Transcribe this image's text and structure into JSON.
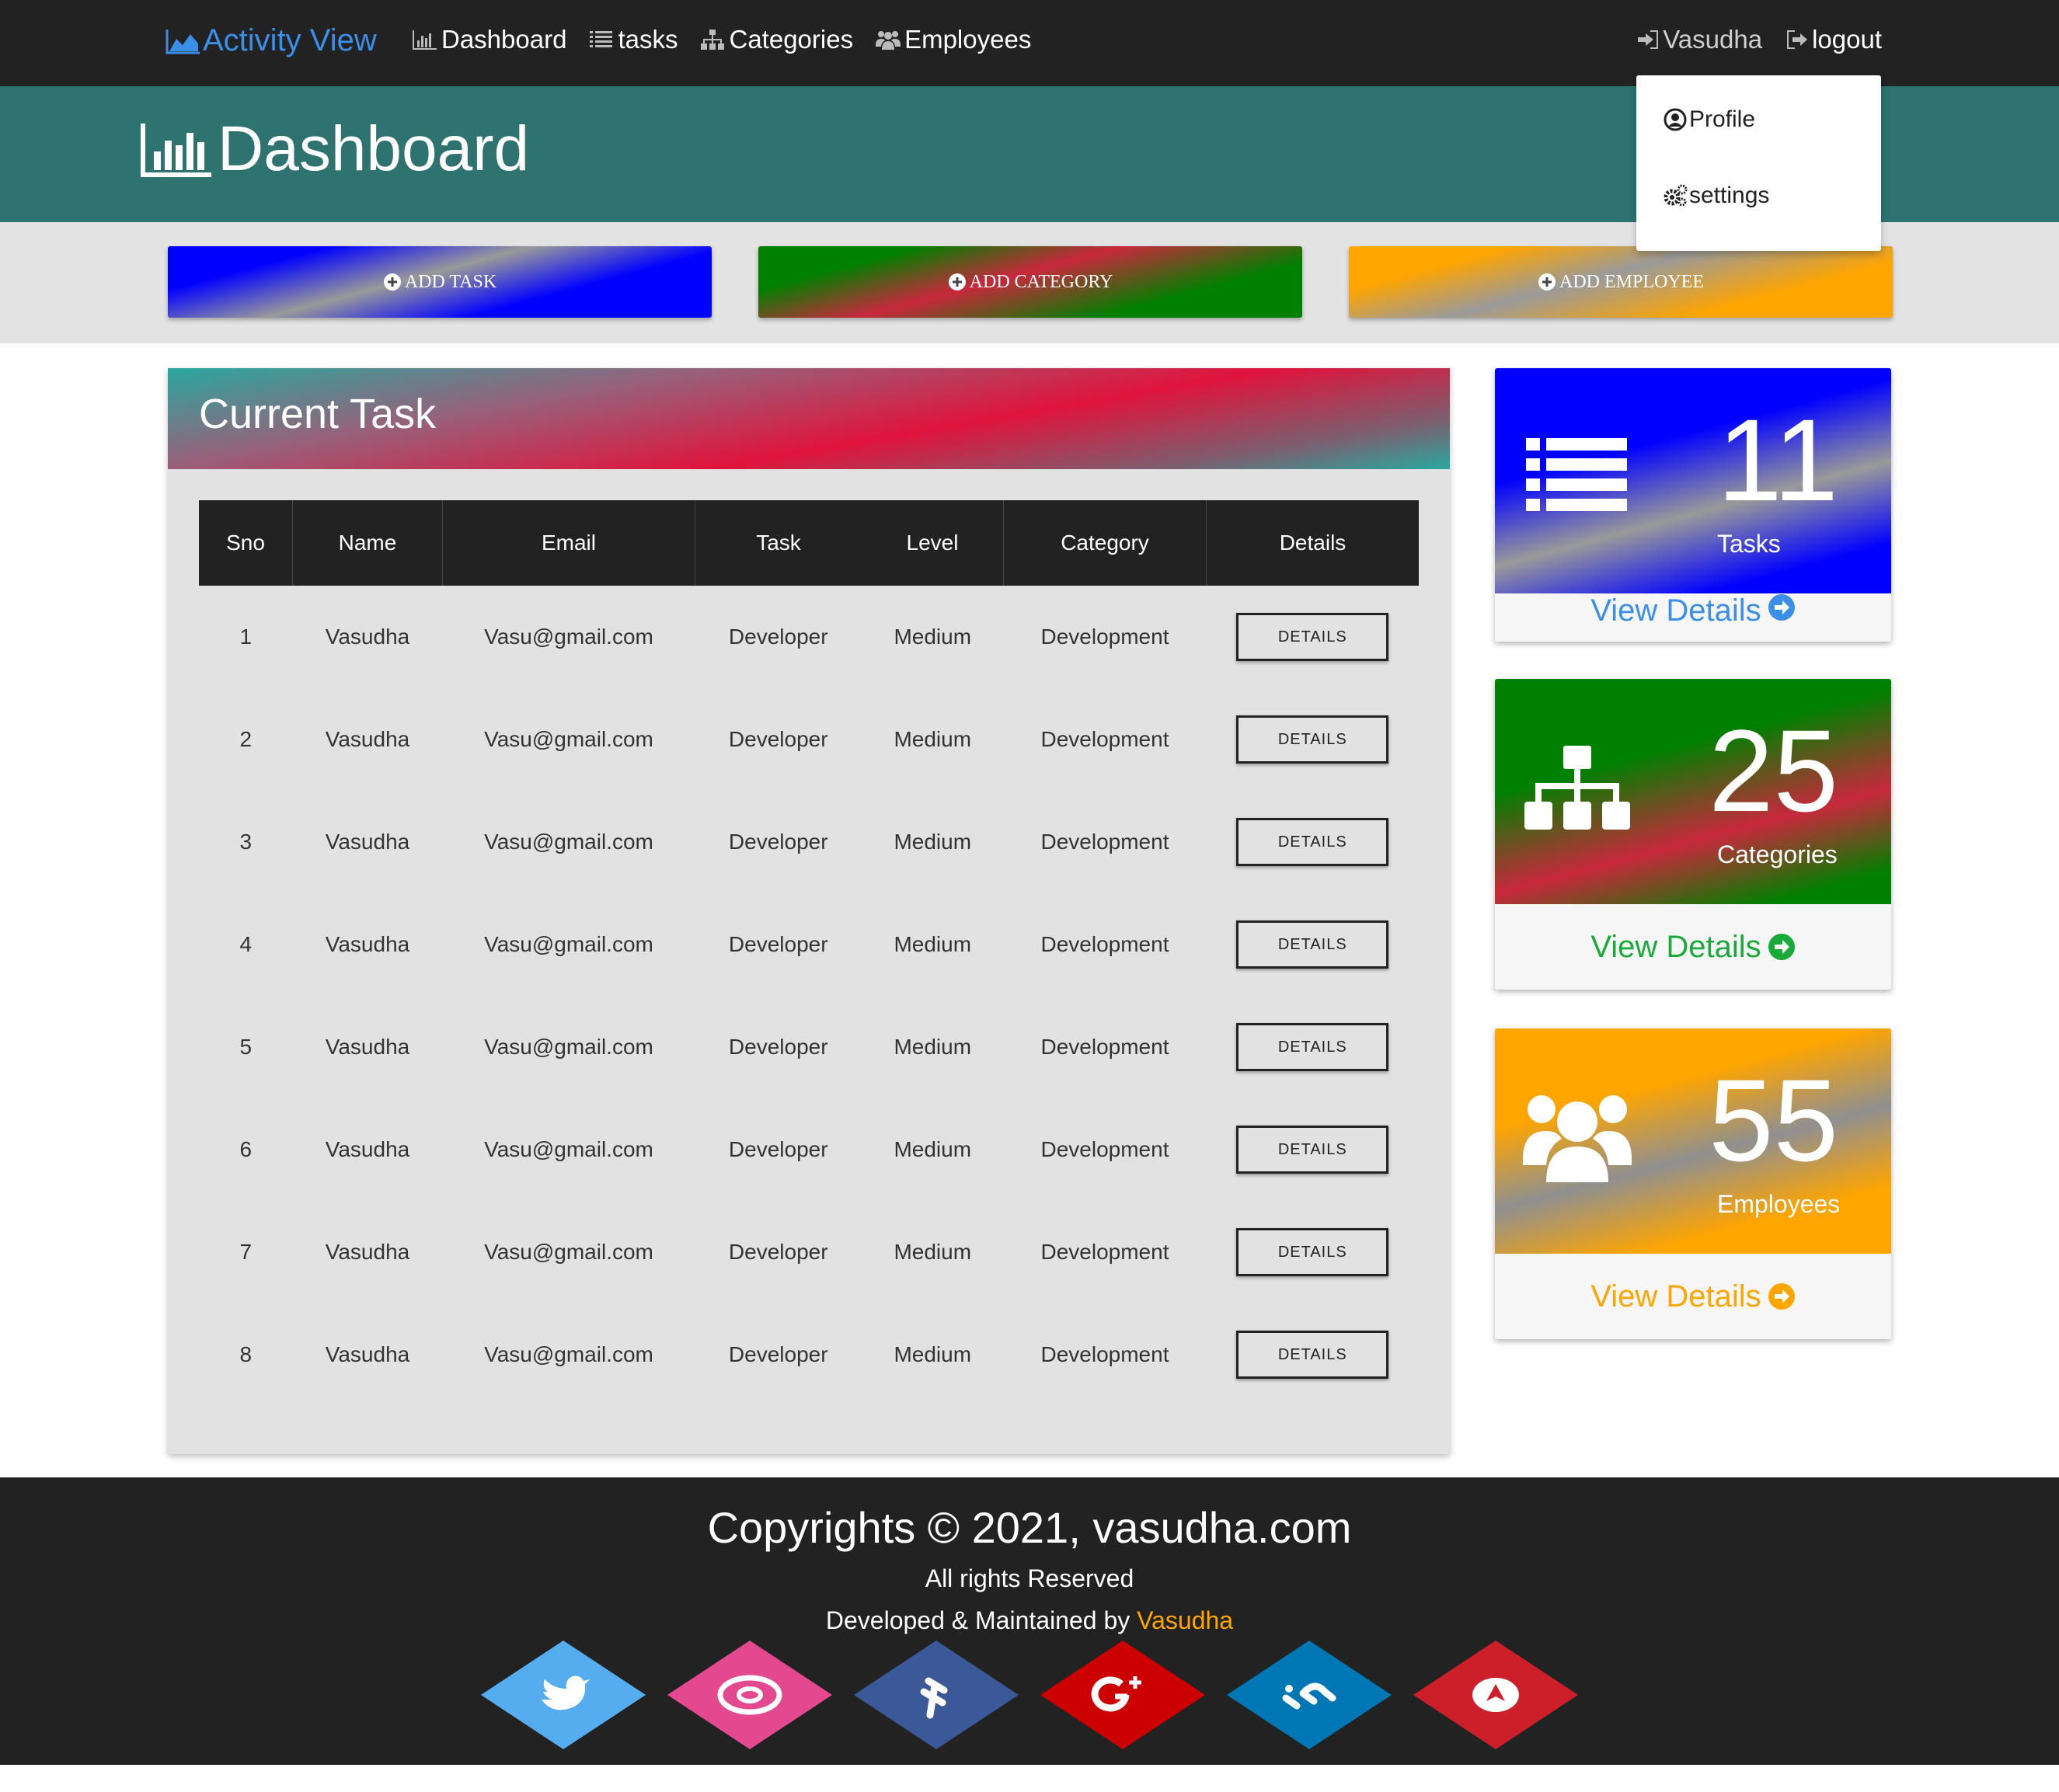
{
  "nav": {
    "brand": "Activity View",
    "links": [
      "Dashboard",
      "tasks",
      "Categories",
      "Employees"
    ],
    "user": "Vasudha",
    "logout": "logout"
  },
  "dropdown": {
    "profile": "Profile",
    "settings": "settings"
  },
  "header": {
    "title": "Dashboard"
  },
  "actions": {
    "add_task": "ADD TASK",
    "add_category": "ADD CATEGORY",
    "add_employee": "ADD EMPLOYEE"
  },
  "task_panel": {
    "title": "Current Task",
    "columns": [
      "Sno",
      "Name",
      "Email",
      "Task",
      "Level",
      "Category",
      "Details"
    ],
    "button_label": "DETAILS",
    "rows": [
      [
        "1",
        "Vasudha",
        "Vasu@gmail.com",
        "Developer",
        "Medium",
        "Development"
      ],
      [
        "2",
        "Vasudha",
        "Vasu@gmail.com",
        "Developer",
        "Medium",
        "Development"
      ],
      [
        "3",
        "Vasudha",
        "Vasu@gmail.com",
        "Developer",
        "Medium",
        "Development"
      ],
      [
        "4",
        "Vasudha",
        "Vasu@gmail.com",
        "Developer",
        "Medium",
        "Development"
      ],
      [
        "5",
        "Vasudha",
        "Vasu@gmail.com",
        "Developer",
        "Medium",
        "Development"
      ],
      [
        "6",
        "Vasudha",
        "Vasu@gmail.com",
        "Developer",
        "Medium",
        "Development"
      ],
      [
        "7",
        "Vasudha",
        "Vasu@gmail.com",
        "Developer",
        "Medium",
        "Development"
      ],
      [
        "8",
        "Vasudha",
        "Vasu@gmail.com",
        "Developer",
        "Medium",
        "Development"
      ]
    ]
  },
  "cards": [
    {
      "count": "11",
      "label": "Tasks",
      "link": "View Details",
      "icon": "list-icon",
      "link_color": "#3b8fe8"
    },
    {
      "count": "25",
      "label": "Categories",
      "link": "View Details",
      "icon": "sitemap-icon",
      "link_color": "#1aaa3a"
    },
    {
      "count": "55",
      "label": "Employees",
      "link": "View Details",
      "icon": "users-icon",
      "link_color": "#ffa500"
    }
  ],
  "footer": {
    "copyright": "Copyrights © 2021, vasudha.com",
    "rights": "All rights Reserved",
    "developed": "Developed & Maintained by ",
    "author": "Vasudha"
  },
  "social": [
    {
      "icon": "twitter-icon",
      "color": "#55acee"
    },
    {
      "icon": "instagram-icon",
      "color": "#e4498f"
    },
    {
      "icon": "facebook-icon",
      "color": "#3b5998"
    },
    {
      "icon": "google-plus-icon",
      "color": "#cc0000"
    },
    {
      "icon": "linkedin-icon",
      "color": "#0077b5"
    },
    {
      "icon": "upload-icon",
      "color": "#cc1f2a"
    }
  ]
}
